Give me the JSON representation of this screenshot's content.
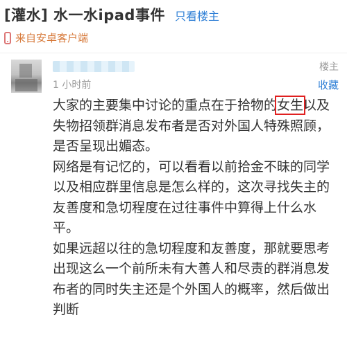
{
  "header": {
    "title": "[灌水] 水一水ipad事件",
    "only_op_label": "只看楼主"
  },
  "source": {
    "label": "来自安卓客户端",
    "icon": "phone-icon"
  },
  "post": {
    "time": "1 小时前",
    "op_label": "楼主",
    "collect_label": "收藏",
    "paragraphs": [
      {
        "before": "大家的主要集中讨论的重点在于拾物的",
        "highlight": "女生",
        "after": "以及失物招领群消息发布者是否对外国人特殊照顾，是否呈现出媚态。"
      },
      {
        "text": "网络是有记忆的，可以看看以前拾金不昧的同学以及相应群里信息是怎么样的，这次寻找失主的友善度和急切程度在过往事件中算得上什么水平。"
      },
      {
        "text": "如果远超以往的急切程度和友善度，那就要思考出现这么一个前所未有大善人和尽责的群消息发布者的同时失主还是个外国人的概率，然后做出判断"
      }
    ]
  },
  "colors": {
    "link": "#2e7fd6",
    "source": "#d77a3b",
    "highlight_box": "#e02020"
  }
}
